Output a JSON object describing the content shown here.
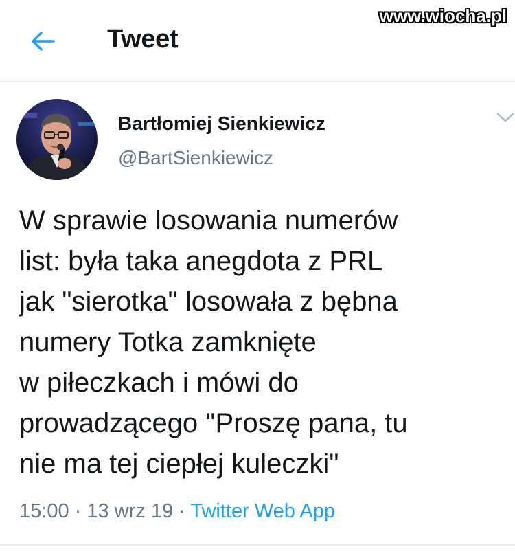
{
  "header": {
    "title": "Tweet",
    "watermark": "www.wiocha.pl"
  },
  "icons": {
    "back": "back-arrow-icon",
    "caret": "chevron-down-icon"
  },
  "colors": {
    "accent": "#1da1f2",
    "text": "#14171a",
    "secondary": "#657786"
  },
  "tweet": {
    "author_name": "Bartłomiej Sienkiewicz",
    "author_handle": "@BartSienkiewicz",
    "text_lines": [
      "W sprawie losowania numerów",
      "list: była taka anegdota z PRL",
      "jak \"sierotka\" losowała z bębna",
      "numery Totka zamknięte",
      "w piłeczkach i mówi do",
      "prowadzącego \"Proszę pana, tu",
      "nie ma tej ciepłej kuleczki\""
    ],
    "time": "15:00",
    "separator": " · ",
    "date": "13 wrz 19",
    "source": "Twitter Web App"
  }
}
